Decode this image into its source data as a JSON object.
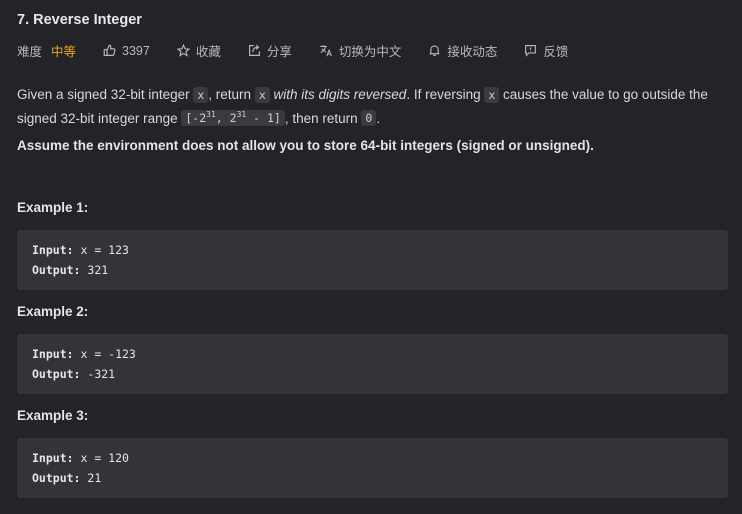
{
  "problem": {
    "title": "7. Reverse Integer"
  },
  "meta": {
    "difficulty_label": "难度",
    "difficulty": "中等",
    "likes": "3397",
    "collect": "收藏",
    "share": "分享",
    "switch_lang": "切换为中文",
    "notify": "接收动态",
    "feedback": "反馈"
  },
  "colors": {
    "background": "#232427",
    "difficulty_medium": "#f0a31d",
    "code_bg": "#333438"
  },
  "description": {
    "p1_a": "Given a signed 32-bit integer ",
    "p1_x1": "x",
    "p1_b": ", return ",
    "p1_x2": "x",
    "p1_em": " with its digits reversed",
    "p1_c": ". If reversing ",
    "p1_x3": "x",
    "p1_d": " causes the value to go outside the signed 32-bit integer range ",
    "range_1": "[-2",
    "range_exp1": "31",
    "range_2": ", 2",
    "range_exp2": "31",
    "range_3": " - 1]",
    "p1_e": ", then return ",
    "zero": "0",
    "p1_f": ".",
    "note": "Assume the environment does not allow you to store 64-bit integers (signed or unsigned)."
  },
  "examples": [
    {
      "heading": "Example 1:",
      "input_label": "Input:",
      "input": " x = 123",
      "output_label": "Output:",
      "output": " 321"
    },
    {
      "heading": "Example 2:",
      "input_label": "Input:",
      "input": " x = -123",
      "output_label": "Output:",
      "output": " -321"
    },
    {
      "heading": "Example 3:",
      "input_label": "Input:",
      "input": " x = 120",
      "output_label": "Output:",
      "output": " 21"
    }
  ]
}
